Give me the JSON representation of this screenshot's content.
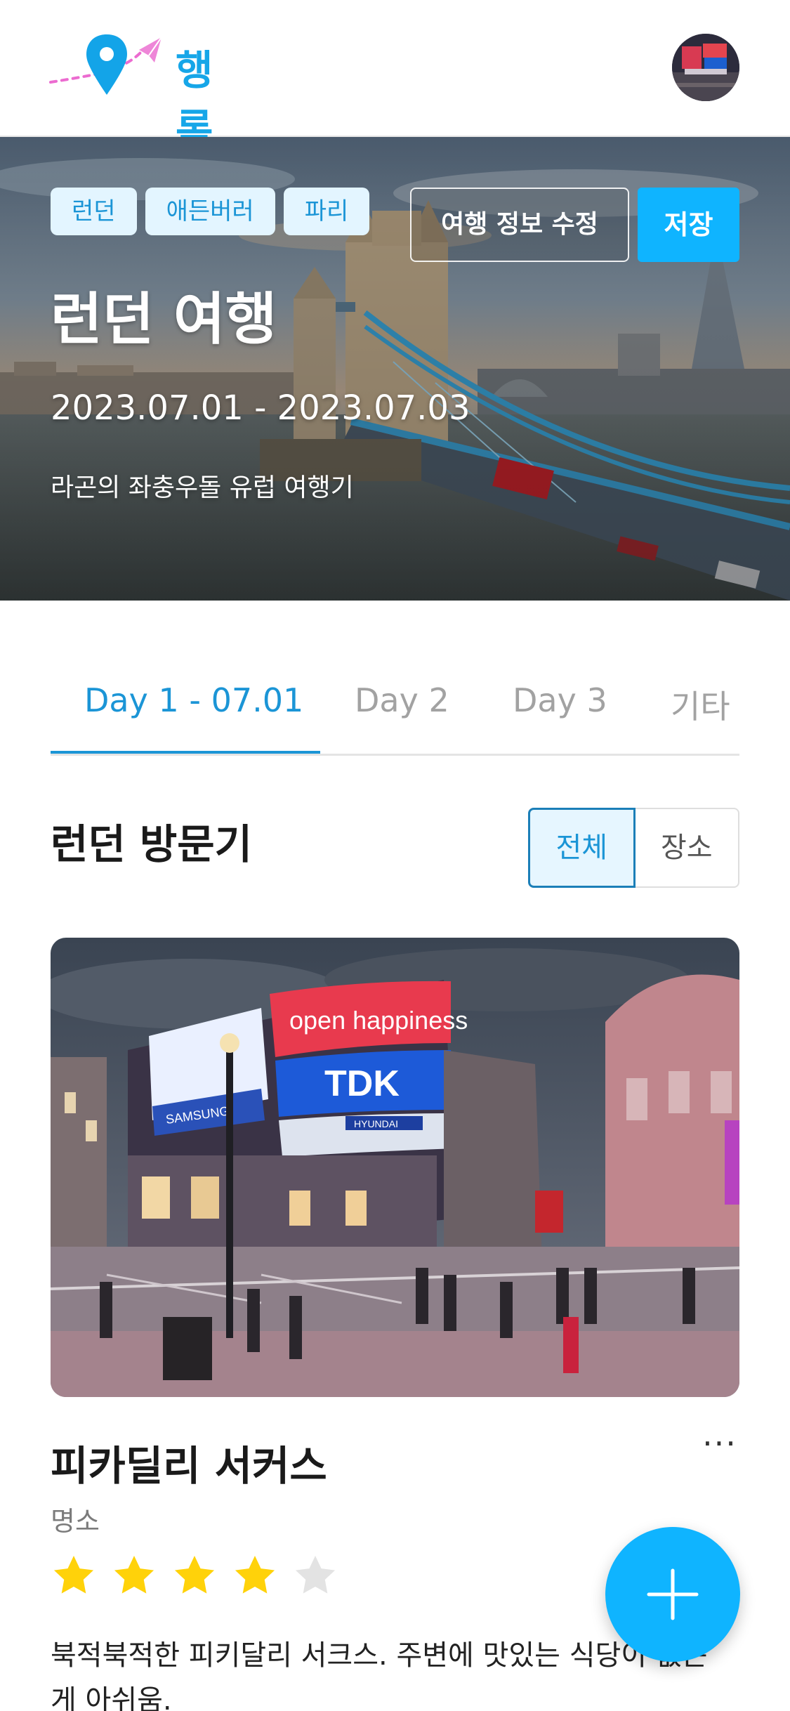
{
  "app": {
    "logo_text": "행록"
  },
  "header": {
    "avatar_alt": "profile avatar"
  },
  "trip": {
    "tags": [
      "런던",
      "애든버러",
      "파리"
    ],
    "edit_label": "여행 정보 수정",
    "save_label": "저장",
    "title": "런던 여행",
    "dates": "2023.07.01 - 2023.07.03",
    "description": "라곤의 좌충우돌 유럽 여행기"
  },
  "tabs": [
    {
      "label": "Day 1 - 07.01",
      "active": true
    },
    {
      "label": "Day 2",
      "active": false
    },
    {
      "label": "Day 3",
      "active": false
    },
    {
      "label": "기타",
      "active": false
    }
  ],
  "section": {
    "title": "런던 방문기",
    "filter_all": "전체",
    "filter_place": "장소"
  },
  "place": {
    "name": "피카딜리 서커스",
    "category": "명소",
    "rating": 4,
    "rating_max": 5,
    "more_label": "···",
    "review": "북적북적한 피키달리 서크스. 주변에 맛있는 식당이 없는게 아쉬움.",
    "photo_text": {
      "sign1": "open happiness",
      "sign2": "TDK",
      "sign3": "HYUNDAI",
      "sign4": "SAMSUNG"
    }
  },
  "colors": {
    "brand": "#16a6e8",
    "accent": "#0fb4ff",
    "chip_bg": "#e3f5ff",
    "star_on": "#ffd20a",
    "star_off": "#e3e3e3"
  },
  "icons": {
    "fab": "plus-icon",
    "logo": "map-pin-plane-icon",
    "more": "more-horizontal-icon",
    "star": "star-icon"
  }
}
